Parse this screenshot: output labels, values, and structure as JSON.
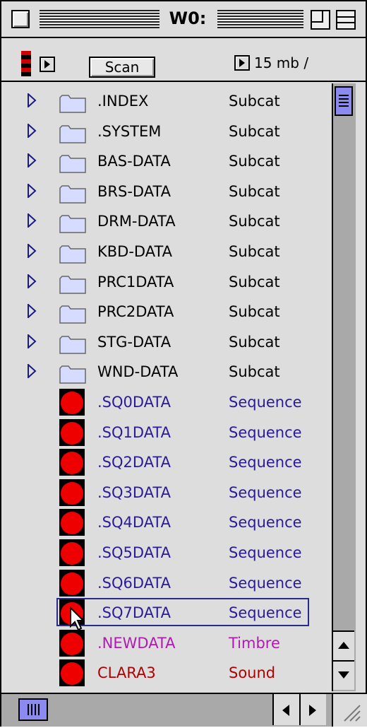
{
  "window": {
    "title": "W0:"
  },
  "toolbar": {
    "scan_label": "Scan",
    "size_text": "15 mb /"
  },
  "rows": [
    {
      "name": ".INDEX",
      "kind": "Subcat",
      "type": "folder"
    },
    {
      "name": ".SYSTEM",
      "kind": "Subcat",
      "type": "folder"
    },
    {
      "name": "BAS-DATA",
      "kind": "Subcat",
      "type": "folder"
    },
    {
      "name": "BRS-DATA",
      "kind": "Subcat",
      "type": "folder"
    },
    {
      "name": "DRM-DATA",
      "kind": "Subcat",
      "type": "folder"
    },
    {
      "name": "KBD-DATA",
      "kind": "Subcat",
      "type": "folder"
    },
    {
      "name": "PRC1DATA",
      "kind": "Subcat",
      "type": "folder"
    },
    {
      "name": "PRC2DATA",
      "kind": "Subcat",
      "type": "folder"
    },
    {
      "name": "STG-DATA",
      "kind": "Subcat",
      "type": "folder"
    },
    {
      "name": "WND-DATA",
      "kind": "Subcat",
      "type": "folder"
    },
    {
      "name": ".SQ0DATA",
      "kind": "Sequence",
      "type": "sequence"
    },
    {
      "name": ".SQ1DATA",
      "kind": "Sequence",
      "type": "sequence"
    },
    {
      "name": ".SQ2DATA",
      "kind": "Sequence",
      "type": "sequence"
    },
    {
      "name": ".SQ3DATA",
      "kind": "Sequence",
      "type": "sequence"
    },
    {
      "name": ".SQ4DATA",
      "kind": "Sequence",
      "type": "sequence"
    },
    {
      "name": ".SQ5DATA",
      "kind": "Sequence",
      "type": "sequence"
    },
    {
      "name": ".SQ6DATA",
      "kind": "Sequence",
      "type": "sequence"
    },
    {
      "name": ".SQ7DATA",
      "kind": "Sequence",
      "type": "sequence"
    },
    {
      "name": ".NEWDATA",
      "kind": "Timbre",
      "type": "timbre"
    },
    {
      "name": "CLARA3",
      "kind": "Sound",
      "type": "sound"
    }
  ],
  "colors": {
    "folder_text": "#000000",
    "sequence_text": "#2a1a9a",
    "timbre_text": "#b01ab0",
    "sound_text": "#b00000",
    "selection_border": "#2a2a8a",
    "scroll_thumb": "#8a8af0",
    "red_icon": "#ee0000"
  },
  "icons": {
    "close_box": "close-box-icon",
    "zoom_box": "zoom-box-icon",
    "collapse_box": "collapse-box-icon",
    "disclosure": "disclosure-triangle-icon",
    "folder": "folder-icon",
    "record": "red-circle-icon"
  }
}
